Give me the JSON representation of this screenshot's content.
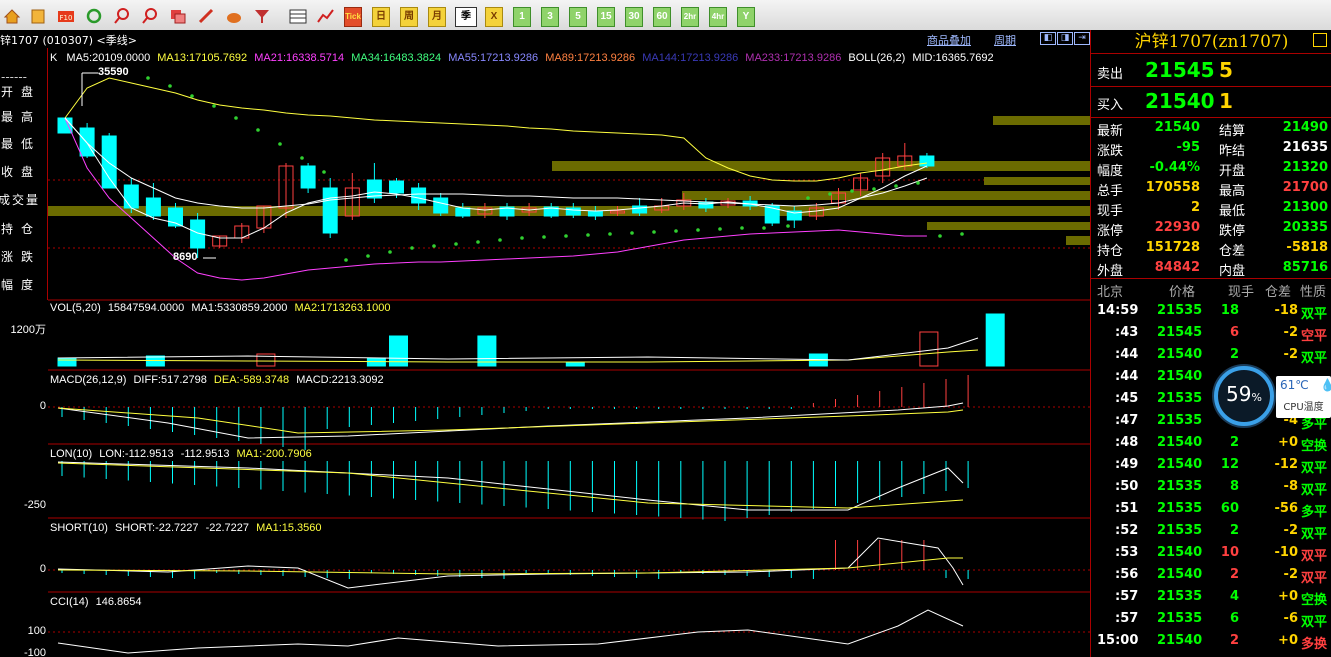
{
  "colors": {
    "up": "#ff4040",
    "down": "#00ffff",
    "price_green": "#00ff00",
    "price_red": "#ff4040",
    "yellow": "#ffd400",
    "grid": "#a00000"
  },
  "toolbar": {
    "icons": [
      "home-icon",
      "folder-icon",
      "f10-icon",
      "refresh-icon",
      "zoom-in-icon",
      "zoom-out-icon",
      "window-icon",
      "pen-icon",
      "gourd-icon",
      "filter-icon",
      "table-icon",
      "chart-line-icon",
      "tick-icon"
    ],
    "tick_label": "Tick",
    "period_buttons": [
      "日",
      "周",
      "月",
      "季",
      "X",
      "1",
      "3",
      "5",
      "15",
      "30",
      "60",
      "2hr",
      "4hr",
      "Y"
    ],
    "selected_period": "季"
  },
  "header": {
    "symbol": "锌1707 (010307) <季线>",
    "overlay_link": "商品叠加",
    "period_link": "周期"
  },
  "left_stats": {
    "separator": "------",
    "labels": [
      "开盘",
      "最高",
      "最低",
      "收盘",
      "成交量",
      "持仓",
      "涨跌",
      "幅度"
    ]
  },
  "panels": {
    "k_title": {
      "k": "K",
      "ma5": "MA5:20109.0000",
      "ma13": "MA13:17105.7692",
      "ma21": "MA21:16338.5714",
      "ma34": "MA34:16483.3824",
      "ma55": "MA55:17213.9286",
      "ma89": "MA89:17213.9286",
      "ma144": "MA144:17213.9286",
      "ma233": "MA233:17213.9286",
      "boll": "BOLL(26,2)",
      "mid": "MID:16365.7692"
    },
    "annotations": {
      "high": "35590",
      "low": "8690"
    },
    "vol_title": {
      "name": "VOL(5,20)",
      "v": "15847594.0000",
      "ma1": "MA1:5330859.2000",
      "ma2": "MA2:1713263.1000"
    },
    "vol_axis": "1200万",
    "macd_title": {
      "name": "MACD(26,12,9)",
      "diff": "DIFF:517.2798",
      "dea": "DEA:-589.3748",
      "macd": "MACD:2213.3092"
    },
    "macd_axis": "0",
    "lon_title": {
      "name": "LON(10)",
      "lon": "LON:-112.9513",
      "v2": "-112.9513",
      "ma1": "MA1:-200.7906"
    },
    "lon_axis": "-250",
    "short_title": {
      "name": "SHORT(10)",
      "short": "SHORT:-22.7227",
      "v2": "-22.7227",
      "ma1": "MA1:15.3560"
    },
    "short_axis": "0",
    "cci_title": {
      "name": "CCI(14)",
      "v": "146.8654"
    },
    "cci_axis_top": "100",
    "cci_axis_bottom": "-100"
  },
  "quote": {
    "title": "沪锌1707(zn1707)",
    "ask_label": "卖出",
    "ask_price": "21545",
    "ask_vol": "5",
    "bid_label": "买入",
    "bid_price": "21540",
    "bid_vol": "1"
  },
  "stats": [
    {
      "k1": "最新",
      "v1": "21540",
      "c1": "#00ff00",
      "k2": "结算",
      "v2": "21490",
      "c2": "#00ff00"
    },
    {
      "k1": "涨跌",
      "v1": "-95",
      "c1": "#00ff00",
      "k2": "昨结",
      "v2": "21635",
      "c2": "#ffffff"
    },
    {
      "k1": "幅度",
      "v1": "-0.44%",
      "c1": "#00ff00",
      "k2": "开盘",
      "v2": "21320",
      "c2": "#00ff00"
    },
    {
      "k1": "总手",
      "v1": "170558",
      "c1": "#ffd400",
      "k2": "最高",
      "v2": "21700",
      "c2": "#ff4040"
    },
    {
      "k1": "现手",
      "v1": "2",
      "c1": "#ffd400",
      "k2": "最低",
      "v2": "21300",
      "c2": "#00ff00"
    },
    {
      "k1": "涨停",
      "v1": "22930",
      "c1": "#ff4040",
      "k2": "跌停",
      "v2": "20335",
      "c2": "#00ff00"
    },
    {
      "k1": "持仓",
      "v1": "151728",
      "c1": "#ffd400",
      "k2": "仓差",
      "v2": "-5818",
      "c2": "#ffd400"
    },
    {
      "k1": "外盘",
      "v1": "84842",
      "c1": "#ff4040",
      "k2": "内盘",
      "v2": "85716",
      "c2": "#00ff00"
    }
  ],
  "ticks_header": [
    "北京",
    "价格",
    "现手",
    "仓差",
    "性质"
  ],
  "ticks": [
    {
      "t": "14:59",
      "p": "21535",
      "v": "18",
      "vc": "#00ff00",
      "d": "-18",
      "n": "双平",
      "nc": "#00ff00"
    },
    {
      "t": ":43",
      "p": "21545",
      "v": "6",
      "vc": "#ff4040",
      "d": "-2",
      "n": "空平",
      "nc": "#ff4040"
    },
    {
      "t": ":44",
      "p": "21540",
      "v": "2",
      "vc": "#00ff00",
      "d": "-2",
      "n": "双平",
      "nc": "#00ff00"
    },
    {
      "t": ":44",
      "p": "21540",
      "v": "",
      "vc": "#00ff00",
      "d": "",
      "n": "",
      "nc": "#00ff00"
    },
    {
      "t": ":45",
      "p": "21535",
      "v": "",
      "vc": "#00ff00",
      "d": "",
      "n": "",
      "nc": "#00ff00"
    },
    {
      "t": ":47",
      "p": "21535",
      "v": "",
      "vc": "#00ff00",
      "d": "-4",
      "n": "多平",
      "nc": "#00ff00"
    },
    {
      "t": ":48",
      "p": "21540",
      "v": "2",
      "vc": "#00ff00",
      "d": "+0",
      "n": "空换",
      "nc": "#00ff00"
    },
    {
      "t": ":49",
      "p": "21540",
      "v": "12",
      "vc": "#00ff00",
      "d": "-12",
      "n": "双平",
      "nc": "#00ff00"
    },
    {
      "t": ":50",
      "p": "21535",
      "v": "8",
      "vc": "#00ff00",
      "d": "-8",
      "n": "双平",
      "nc": "#00ff00"
    },
    {
      "t": ":51",
      "p": "21535",
      "v": "60",
      "vc": "#00ff00",
      "d": "-56",
      "n": "多平",
      "nc": "#00ff00"
    },
    {
      "t": ":52",
      "p": "21535",
      "v": "2",
      "vc": "#00ff00",
      "d": "-2",
      "n": "双平",
      "nc": "#00ff00"
    },
    {
      "t": ":53",
      "p": "21540",
      "v": "10",
      "vc": "#ff4040",
      "d": "-10",
      "n": "双平",
      "nc": "#ff4040"
    },
    {
      "t": ":56",
      "p": "21540",
      "v": "2",
      "vc": "#ff4040",
      "d": "-2",
      "n": "双平",
      "nc": "#ff4040"
    },
    {
      "t": ":57",
      "p": "21535",
      "v": "4",
      "vc": "#00ff00",
      "d": "+0",
      "n": "空换",
      "nc": "#00ff00"
    },
    {
      "t": ":57",
      "p": "21535",
      "v": "6",
      "vc": "#00ff00",
      "d": "-6",
      "n": "双平",
      "nc": "#00ff00"
    },
    {
      "t": "15:00",
      "p": "21540",
      "v": "2",
      "vc": "#ff4040",
      "d": "+0",
      "n": "多换",
      "nc": "#ff4040"
    }
  ],
  "cpu": {
    "percent": "59",
    "percent_sign": "%",
    "temp": "61℃",
    "label": "CPU温度"
  }
}
